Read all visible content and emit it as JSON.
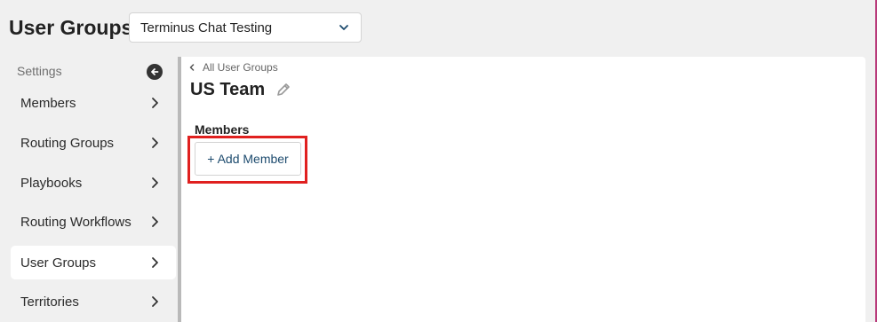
{
  "page": {
    "title": "User Groups"
  },
  "org_select": {
    "value": "Terminus Chat Testing"
  },
  "sidebar": {
    "header": "Settings",
    "items": [
      {
        "label": "Members",
        "active": false
      },
      {
        "label": "Routing Groups",
        "active": false
      },
      {
        "label": "Playbooks",
        "active": false
      },
      {
        "label": "Routing Workflows",
        "active": false
      },
      {
        "label": "User Groups",
        "active": true
      },
      {
        "label": "Territories",
        "active": false
      }
    ]
  },
  "panel": {
    "back_label": "All User Groups",
    "group_name": "US Team",
    "members_label": "Members",
    "add_member_label": "+ Add Member"
  },
  "colors": {
    "highlight": "#e0201f",
    "link": "#1d4b6e"
  }
}
